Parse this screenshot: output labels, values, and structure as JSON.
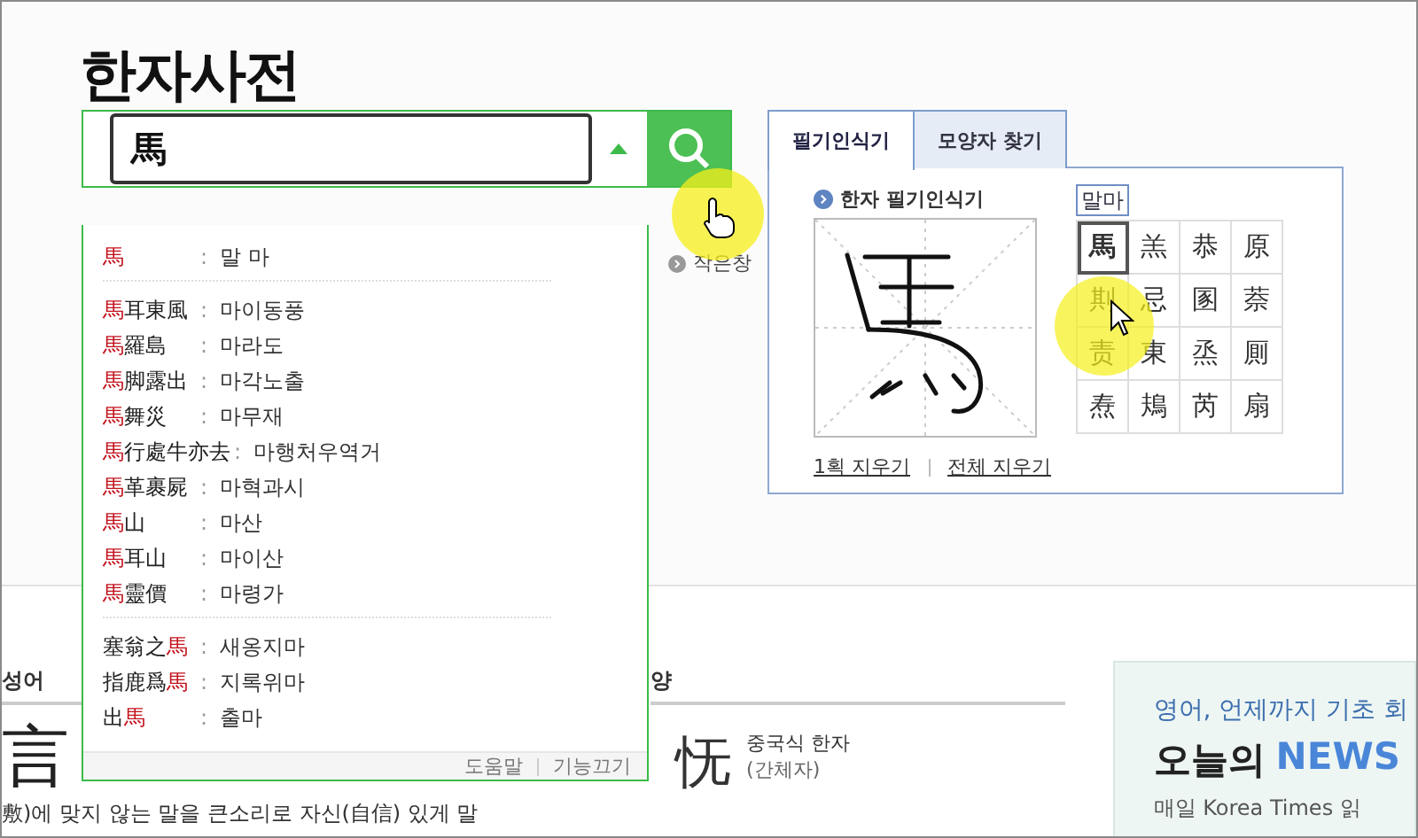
{
  "title": "한자사전",
  "search": {
    "value": "馬"
  },
  "behind_link": "작은창",
  "suggestions": {
    "groups": [
      [
        {
          "hanja": [
            {
              "text": "馬",
              "match": true
            }
          ],
          "separator": ":",
          "reading": "말 마"
        }
      ],
      [
        {
          "hanja": [
            {
              "text": "馬",
              "match": true
            },
            {
              "text": "耳東風",
              "match": false
            }
          ],
          "separator": ":",
          "reading": "마이동풍"
        },
        {
          "hanja": [
            {
              "text": "馬",
              "match": true
            },
            {
              "text": "羅島",
              "match": false
            }
          ],
          "separator": ":",
          "reading": "마라도"
        },
        {
          "hanja": [
            {
              "text": "馬",
              "match": true
            },
            {
              "text": "脚露出",
              "match": false
            }
          ],
          "separator": ":",
          "reading": "마각노출"
        },
        {
          "hanja": [
            {
              "text": "馬",
              "match": true
            },
            {
              "text": "舞災",
              "match": false
            }
          ],
          "separator": ":",
          "reading": "마무재"
        },
        {
          "hanja": [
            {
              "text": "馬",
              "match": true
            },
            {
              "text": "行處牛亦去",
              "match": false
            }
          ],
          "separator": ":",
          "reading": "마행처우역거"
        },
        {
          "hanja": [
            {
              "text": "馬",
              "match": true
            },
            {
              "text": "革裹屍",
              "match": false
            }
          ],
          "separator": ":",
          "reading": "마혁과시"
        },
        {
          "hanja": [
            {
              "text": "馬",
              "match": true
            },
            {
              "text": "山",
              "match": false
            }
          ],
          "separator": ":",
          "reading": "마산"
        },
        {
          "hanja": [
            {
              "text": "馬",
              "match": true
            },
            {
              "text": "耳山",
              "match": false
            }
          ],
          "separator": ":",
          "reading": "마이산"
        },
        {
          "hanja": [
            {
              "text": "馬",
              "match": true
            },
            {
              "text": "靈價",
              "match": false
            }
          ],
          "separator": ":",
          "reading": "마령가"
        }
      ],
      [
        {
          "hanja": [
            {
              "text": "塞翁之",
              "match": false
            },
            {
              "text": "馬",
              "match": true
            }
          ],
          "separator": ":",
          "reading": "새옹지마"
        },
        {
          "hanja": [
            {
              "text": "指鹿爲",
              "match": false
            },
            {
              "text": "馬",
              "match": true
            }
          ],
          "separator": ":",
          "reading": "지록위마"
        },
        {
          "hanja": [
            {
              "text": "出",
              "match": false
            },
            {
              "text": "馬",
              "match": true
            }
          ],
          "separator": ":",
          "reading": "출마"
        }
      ]
    ],
    "footer": [
      "도움말",
      "기능끄기"
    ]
  },
  "recognizer": {
    "tabs": [
      {
        "label": "필기인식기",
        "selected": true
      },
      {
        "label": "모양자 찾기",
        "selected": false
      }
    ],
    "heading": "한자 필기인식기",
    "actions": [
      "1획 지우기",
      "전체 지우기"
    ],
    "candidate_reading": "말마",
    "candidates": [
      {
        "char": "馬",
        "selected": true
      },
      {
        "char": "羔",
        "selected": false
      },
      {
        "char": "恭",
        "selected": false
      },
      {
        "char": "原",
        "selected": false
      },
      {
        "char": "剘",
        "selected": false
      },
      {
        "char": "忌",
        "selected": false
      },
      {
        "char": "圂",
        "selected": false
      },
      {
        "char": "萘",
        "selected": false
      },
      {
        "char": "责",
        "selected": false
      },
      {
        "char": "東",
        "selected": false
      },
      {
        "char": "烝",
        "selected": false
      },
      {
        "char": "厠",
        "selected": false
      },
      {
        "char": "焘",
        "selected": false
      },
      {
        "char": "鳺",
        "selected": false
      },
      {
        "char": "芮",
        "selected": false
      },
      {
        "char": "扇",
        "selected": false
      }
    ]
  },
  "idioms": {
    "heading": "성어",
    "hanja": "言",
    "definition": "敷)에 맞지 않는 말을 큰소리로 자신(自信) 있게 말"
  },
  "shapes": {
    "heading": "양",
    "char": "怃",
    "label": "중국식 한자",
    "note": "(간체자)"
  },
  "ad": {
    "line1": "영어, 언제까지 기초 회",
    "line2": "오늘의",
    "highlight": "NEWS",
    "line3": "매일 Korea Times 읽"
  }
}
